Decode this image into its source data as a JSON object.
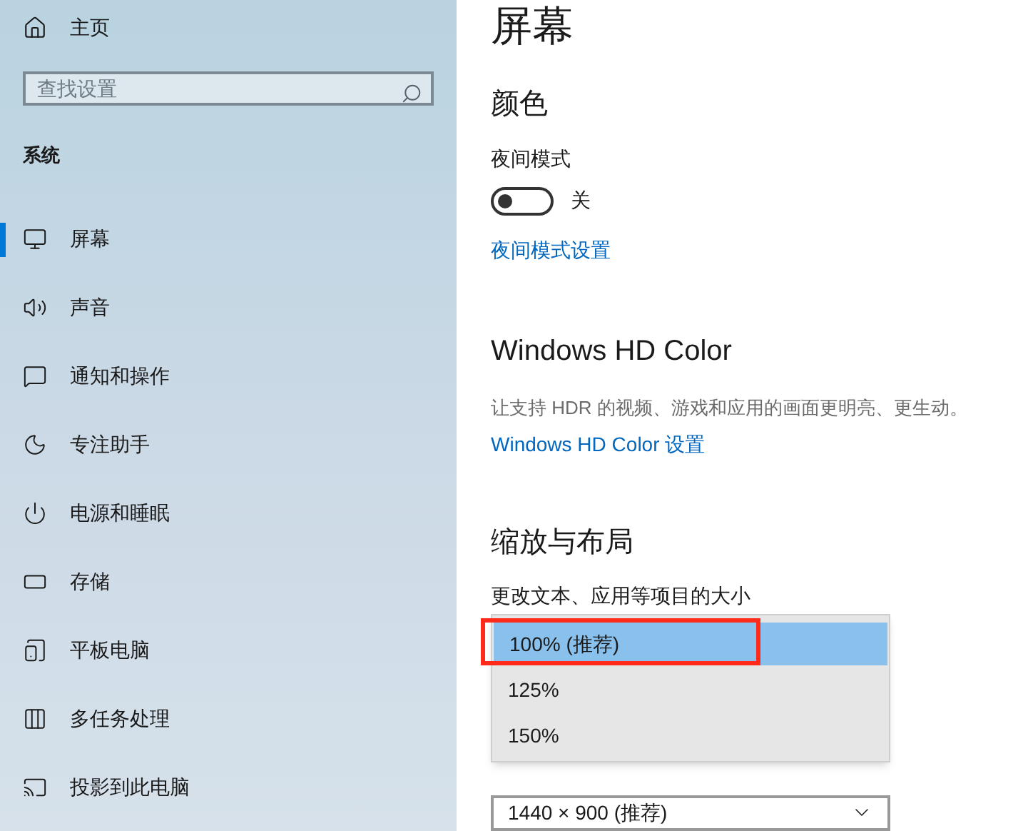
{
  "sidebar": {
    "home": "主页",
    "search": {
      "placeholder": "查找设置"
    },
    "section": "系统",
    "items": [
      {
        "label": "屏幕",
        "kind": "display",
        "selected": true
      },
      {
        "label": "声音",
        "kind": "sound",
        "selected": false
      },
      {
        "label": "通知和操作",
        "kind": "notifications",
        "selected": false
      },
      {
        "label": "专注助手",
        "kind": "focus",
        "selected": false
      },
      {
        "label": "电源和睡眠",
        "kind": "power",
        "selected": false
      },
      {
        "label": "存储",
        "kind": "storage",
        "selected": false
      },
      {
        "label": "平板电脑",
        "kind": "tablet",
        "selected": false
      },
      {
        "label": "多任务处理",
        "kind": "multitask",
        "selected": false
      },
      {
        "label": "投影到此电脑",
        "kind": "project",
        "selected": false
      }
    ]
  },
  "main": {
    "title": "屏幕",
    "color_heading": "颜色",
    "night_mode": {
      "label": "夜间模式",
      "on": false,
      "state_text": "关"
    },
    "night_mode_link": "夜间模式设置",
    "hd_heading": "Windows HD Color",
    "hd_description": "让支持 HDR 的视频、游戏和应用的画面更明亮、更生动。",
    "hd_link": "Windows HD Color 设置",
    "scale_heading": "缩放与布局",
    "scale_label": "更改文本、应用等项目的大小",
    "scale_options": [
      {
        "label": "100% (推荐)",
        "selected": true,
        "highlighted": true
      },
      {
        "label": "125%",
        "selected": false,
        "highlighted": false
      },
      {
        "label": "150%",
        "selected": false,
        "highlighted": false
      }
    ],
    "resolution": {
      "value": "1440 × 900 (推荐)"
    }
  }
}
